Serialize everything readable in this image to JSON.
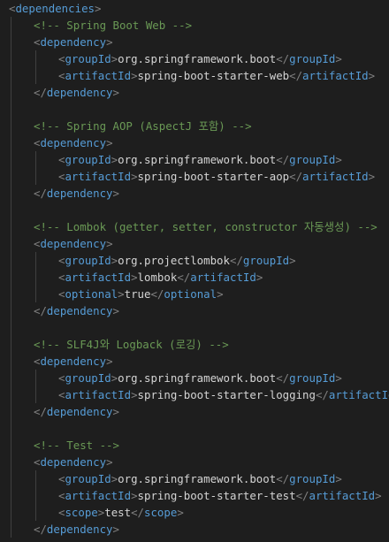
{
  "file": {
    "dependencies_tag": "dependencies",
    "dependency_tag": "dependency",
    "tags": {
      "groupId": "groupId",
      "artifactId": "artifactId",
      "optional": "optional",
      "scope": "scope"
    },
    "blocks": [
      {
        "comment": "<!-- Spring Boot Web -->",
        "groupId": "org.springframework.boot",
        "artifactId": "spring-boot-starter-web"
      },
      {
        "comment": "<!-- Spring AOP (AspectJ 포함) -->",
        "groupId": "org.springframework.boot",
        "artifactId": "spring-boot-starter-aop"
      },
      {
        "comment": "<!-- Lombok (getter, setter, constructor 자동생성) -->",
        "groupId": "org.projectlombok",
        "artifactId": "lombok",
        "optional": "true"
      },
      {
        "comment": "<!-- SLF4J와 Logback (로깅) -->",
        "groupId": "org.springframework.boot",
        "artifactId": "spring-boot-starter-logging"
      },
      {
        "comment": "<!-- Test -->",
        "groupId": "org.springframework.boot",
        "artifactId": "spring-boot-starter-test",
        "scope": "test"
      }
    ]
  }
}
